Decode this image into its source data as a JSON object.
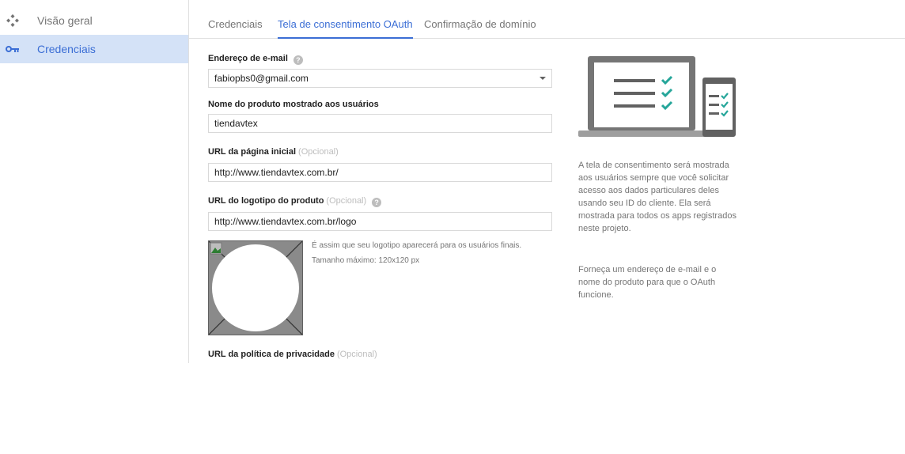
{
  "sidebar": {
    "items": [
      {
        "label": "Visão geral",
        "icon": "overview-icon"
      },
      {
        "label": "Credenciais",
        "icon": "key-icon",
        "active": true
      }
    ]
  },
  "tabs": [
    {
      "label": "Credenciais"
    },
    {
      "label": "Tela de consentimento OAuth",
      "active": true
    },
    {
      "label": "Confirmação de domínio"
    }
  ],
  "form": {
    "email": {
      "label": "Endereço de e-mail",
      "value": "fabiopbs0@gmail.com"
    },
    "product_name": {
      "label": "Nome do produto mostrado aos usuários",
      "value": "tiendavtex"
    },
    "homepage": {
      "label": "URL da página inicial",
      "optional": "(Opcional)",
      "value": "http://www.tiendavtex.com.br/"
    },
    "logo_url": {
      "label": "URL do logotipo do produto",
      "optional": "(Opcional)",
      "value": "http://www.tiendavtex.com.br/logo"
    },
    "logo_hint_line1": "É assim que seu logotipo aparecerá para os usuários finais.",
    "logo_hint_line2": "Tamanho máximo: 120x120 px",
    "privacy": {
      "label": "URL da política de privacidade",
      "optional": "(Opcional)"
    }
  },
  "info": {
    "paragraph1": "A tela de consentimento será mostrada aos usuários sempre que você solicitar acesso aos dados particulares deles usando seu ID do cliente. Ela será mostrada para todos os apps registrados neste projeto.",
    "paragraph2": "Forneça um endereço de e-mail e o nome do produto para que o OAuth funcione."
  },
  "colors": {
    "accent": "#3b6ed5",
    "active_nav_bg": "#d4e2f7",
    "check_green": "#26a69a",
    "device_gray": "#757575"
  }
}
